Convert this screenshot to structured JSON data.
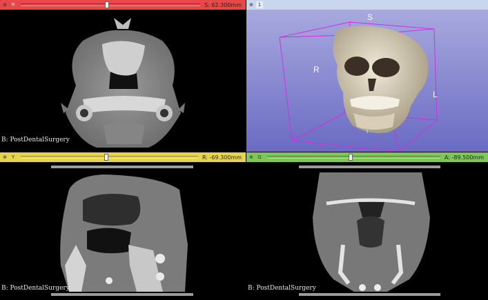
{
  "colors": {
    "red_bar": "#e8484a",
    "yellow_bar": "#e6d44a",
    "green_bar": "#7ec858",
    "threeD_bar": "#c9d7ee",
    "threeD_bg_top": "#a8a9de",
    "threeD_bg_bottom": "#6a6bc3",
    "box": "#d22de0"
  },
  "views": {
    "red": {
      "label": "R",
      "position": "S: 62.300mm",
      "slider": 0.47,
      "caption": "B: PostDentalSurgery"
    },
    "threeD": {
      "label": "1",
      "orientation": {
        "superior": "S",
        "right": "R",
        "left": "L",
        "inferior": "I"
      }
    },
    "yellow": {
      "label": "Y",
      "position": "R: -69.300mm",
      "slider": 0.47,
      "caption": "B: PostDentalSurgery"
    },
    "green": {
      "label": "G",
      "position": "A: -89.500mm",
      "slider": 0.47,
      "caption": "B: PostDentalSurgery"
    }
  }
}
